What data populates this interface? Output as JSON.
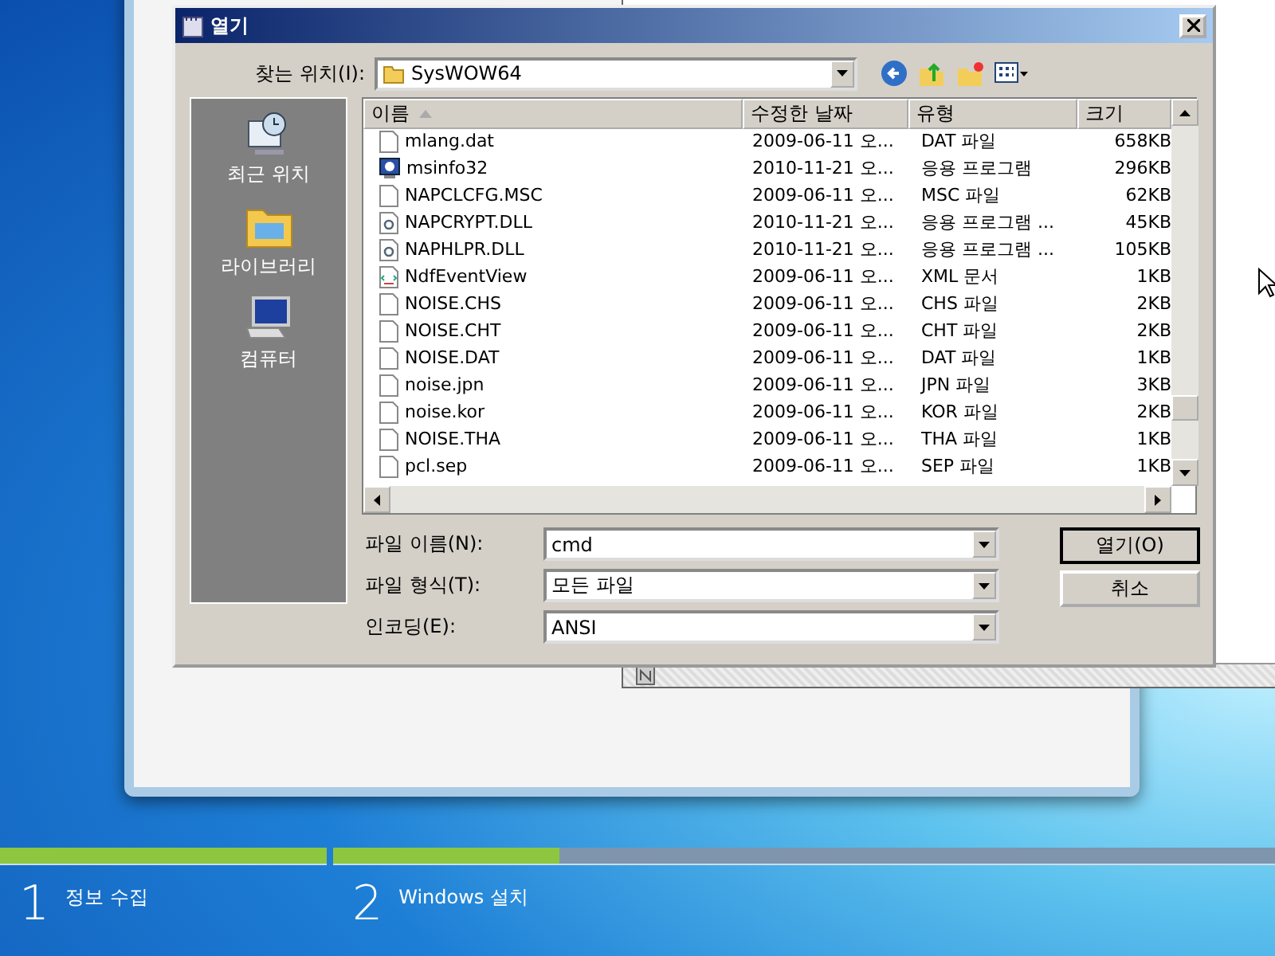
{
  "dialog": {
    "title": "열기",
    "look_in_label": "찾는 위치(I):",
    "look_in_value": "SysWOW64",
    "places": [
      {
        "label": "최근 위치",
        "kind": "recent"
      },
      {
        "label": "라이브러리",
        "kind": "library"
      },
      {
        "label": "컴퓨터",
        "kind": "computer"
      }
    ],
    "columns": [
      {
        "label": "이름",
        "sorted": true
      },
      {
        "label": "수정한 날짜",
        "sorted": false
      },
      {
        "label": "유형",
        "sorted": false
      },
      {
        "label": "크기",
        "sorted": false
      }
    ],
    "files": [
      {
        "name": "mlang.dat",
        "date": "2009-06-11 오...",
        "type": "DAT 파일",
        "size": "658KB",
        "kind": "file"
      },
      {
        "name": "msinfo32",
        "date": "2010-11-21 오...",
        "type": "응용 프로그램",
        "size": "296KB",
        "kind": "app"
      },
      {
        "name": "NAPCLCFG.MSC",
        "date": "2009-06-11 오...",
        "type": "MSC 파일",
        "size": "62KB",
        "kind": "file"
      },
      {
        "name": "NAPCRYPT.DLL",
        "date": "2010-11-21 오...",
        "type": "응용 프로그램 ...",
        "size": "45KB",
        "kind": "dll"
      },
      {
        "name": "NAPHLPR.DLL",
        "date": "2010-11-21 오...",
        "type": "응용 프로그램 ...",
        "size": "105KB",
        "kind": "dll"
      },
      {
        "name": "NdfEventView",
        "date": "2009-06-11 오...",
        "type": "XML 문서",
        "size": "1KB",
        "kind": "xml"
      },
      {
        "name": "NOISE.CHS",
        "date": "2009-06-11 오...",
        "type": "CHS 파일",
        "size": "2KB",
        "kind": "file"
      },
      {
        "name": "NOISE.CHT",
        "date": "2009-06-11 오...",
        "type": "CHT 파일",
        "size": "2KB",
        "kind": "file"
      },
      {
        "name": "NOISE.DAT",
        "date": "2009-06-11 오...",
        "type": "DAT 파일",
        "size": "1KB",
        "kind": "file"
      },
      {
        "name": "noise.jpn",
        "date": "2009-06-11 오...",
        "type": "JPN 파일",
        "size": "3KB",
        "kind": "file"
      },
      {
        "name": "noise.kor",
        "date": "2009-06-11 오...",
        "type": "KOR 파일",
        "size": "2KB",
        "kind": "file"
      },
      {
        "name": "NOISE.THA",
        "date": "2009-06-11 오...",
        "type": "THA 파일",
        "size": "1KB",
        "kind": "file"
      },
      {
        "name": "pcl.sep",
        "date": "2009-06-11 오...",
        "type": "SEP 파일",
        "size": "1KB",
        "kind": "file"
      }
    ],
    "fields": [
      {
        "label": "파일 이름(N):",
        "value": "cmd"
      },
      {
        "label": "파일 형식(T):",
        "value": "모든 파일"
      },
      {
        "label": "인코딩(E):",
        "value": "ANSI"
      }
    ],
    "buttons": [
      {
        "label": "열기(O)",
        "default": true
      },
      {
        "label": "취소",
        "default": false
      }
    ]
  },
  "setup_steps": [
    {
      "number": "1",
      "label": "정보 수집",
      "level": 1
    },
    {
      "number": "2",
      "label": "Windows 설치",
      "level": 0.24
    }
  ]
}
